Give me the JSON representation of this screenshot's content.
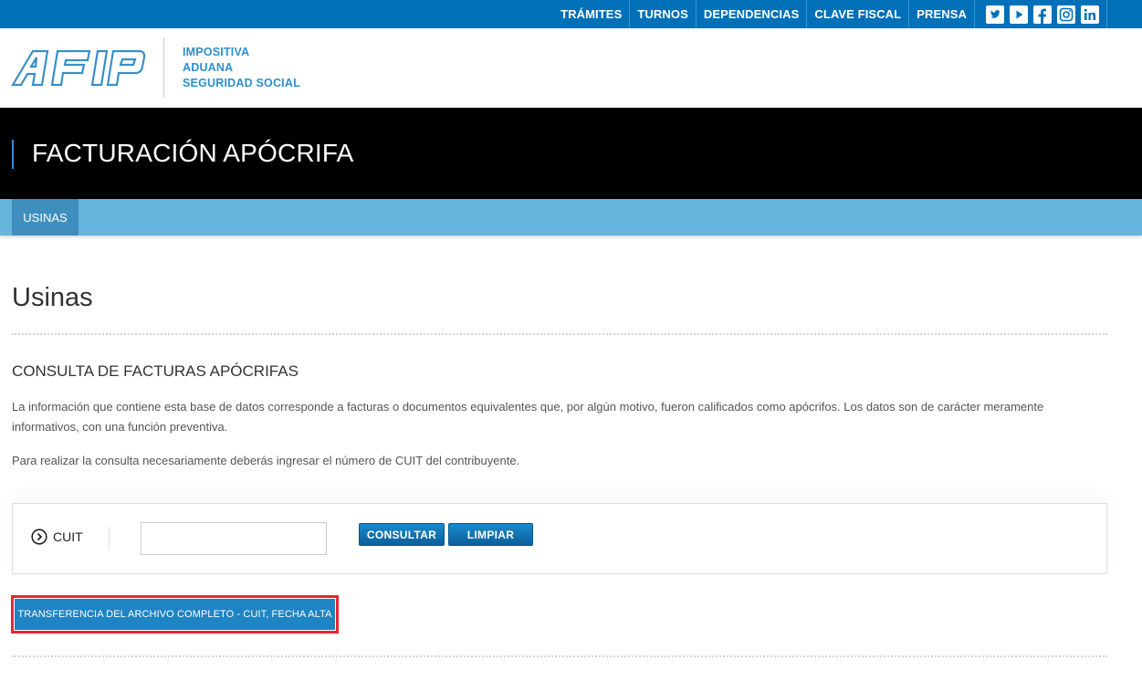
{
  "topbar": {
    "links": [
      "TRÁMITES",
      "TURNOS",
      "DEPENDENCIAS",
      "CLAVE FISCAL",
      "PRENSA"
    ],
    "social_icons": [
      "twitter-icon",
      "youtube-icon",
      "facebook-icon",
      "instagram-icon",
      "linkedin-icon"
    ],
    "background": "#0070b8"
  },
  "header": {
    "logo_text": "AFIP",
    "subbrand": [
      "IMPOSITIVA",
      "ADUANA",
      "SEGURIDAD SOCIAL"
    ]
  },
  "band": {
    "title": "FACTURACIÓN APÓCRIFA"
  },
  "nav": {
    "tabs": [
      "USINAS"
    ]
  },
  "main": {
    "page_title": "Usinas",
    "section_title": "CONSULTA DE FACTURAS APÓCRIFAS",
    "paragraph_1": "La información que contiene esta base de datos corresponde a facturas o documentos equivalentes que, por algún motivo, fueron calificados como apócrifos. Los datos son de carácter meramente informativos, con una función preventiva.",
    "paragraph_2": "Para realizar la consulta necesariamente deberás ingresar el número de CUIT del contribuyente.",
    "form": {
      "cuit_label": "CUIT",
      "cuit_value": "",
      "consultar_label": "CONSULTAR",
      "limpiar_label": "LIMPIAR"
    },
    "transfer_label": "TRANSFERENCIA DEL ARCHIVO COMPLETO - CUIT, FECHA ALTA"
  },
  "colors": {
    "accent": "#0070b8",
    "nav": "#66b5df",
    "nav_active": "#3f8fbe",
    "highlight": "#e8262f"
  }
}
